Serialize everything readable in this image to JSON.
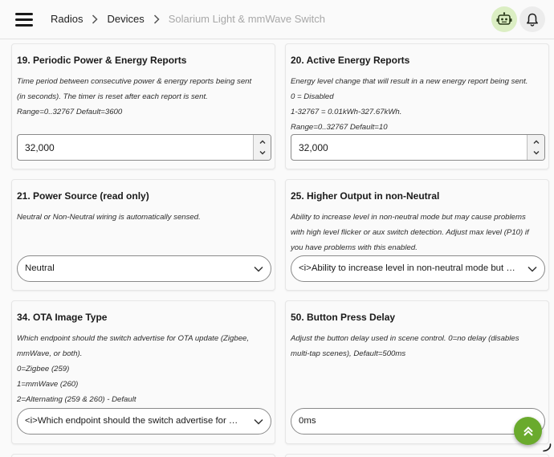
{
  "breadcrumb": {
    "items": [
      "Radios",
      "Devices"
    ],
    "current": "Solarium Light & mmWave Switch"
  },
  "icons": {
    "menu": "hamburger-menu-icon",
    "assistant": "robot-icon",
    "notifications": "bell-icon",
    "scroll_top": "double-chevron-up-icon",
    "loading": "loading-spinner-icon"
  },
  "colors": {
    "assistant_bg": "#dbeec3",
    "fab_bg": "#6aaa2d",
    "current_crumb": "#a8a8a8"
  },
  "cards": [
    {
      "title": "19. Periodic Power & Energy Reports",
      "desc": [
        "Time period between consecutive power & energy reports being sent",
        "(in seconds). The timer is reset after each report is sent.",
        "Range=0..32767 Default=3600"
      ],
      "value": "32,000"
    },
    {
      "title": "20. Active Energy Reports",
      "desc": [
        "Energy level change that will result in a new energy report being sent.",
        "0 = Disabled",
        "1-32767 = 0.01kWh-327.67kWh.",
        "Range=0..32767 Default=10"
      ],
      "value": "32,000"
    },
    {
      "title": "21. Power Source (read only)",
      "desc": [
        "Neutral or Non-Neutral wiring is automatically sensed."
      ],
      "value": "Neutral"
    },
    {
      "title": "25. Higher Output in non-Neutral",
      "desc": [
        "Ability to increase level in non-neutral mode but may cause problems",
        "with high level flicker or aux switch detection. Adjust max level (P10) if",
        "you have problems with this enabled."
      ],
      "value": "<i>Ability to increase level in non-neutral mode but may cause problems with high level flicker or aux switch detection"
    },
    {
      "title": "34. OTA Image Type",
      "desc": [
        "Which endpoint should the switch advertise for OTA update (Zigbee,",
        "mmWave, or both).",
        "0=Zigbee (259)",
        "1=mmWave (260)",
        "2=Alternating (259 & 260) - Default"
      ],
      "value": "<i>Which endpoint should the switch advertise for OTA update (Zigbee, mmWave, or both)"
    },
    {
      "title": "50. Button Press Delay",
      "desc": [
        "Adjust the button delay used in scene control. 0=no delay (disables",
        "multi-tap scenes), Default=500ms"
      ],
      "value": "0ms"
    }
  ]
}
